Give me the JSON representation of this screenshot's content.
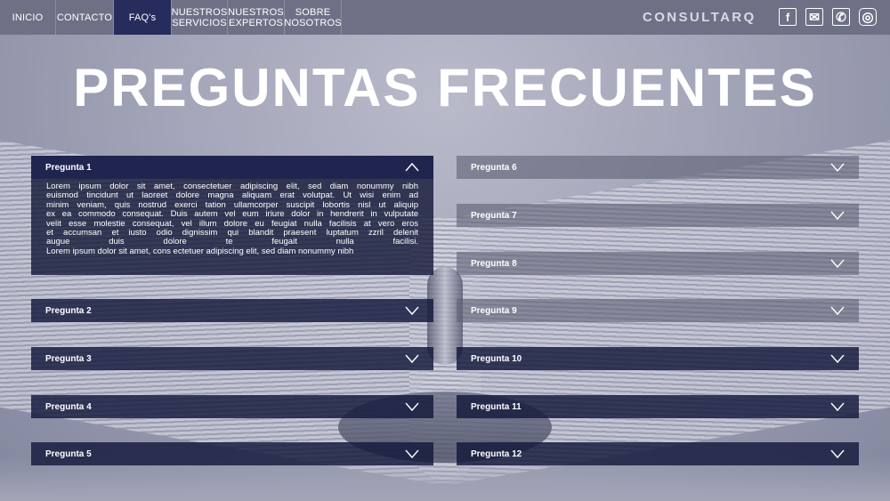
{
  "nav": {
    "items": [
      {
        "label": "INICIO"
      },
      {
        "label": "CONTACTO"
      },
      {
        "label": "FAQ's"
      },
      {
        "label": "NUESTROS SERVICIOS"
      },
      {
        "label": "NUESTROS EXPERTOS"
      },
      {
        "label": "SOBRE NOSOTROS"
      }
    ],
    "brand": "CONSULTARQ",
    "social_icons": [
      "facebook-icon",
      "mail-icon",
      "phone-icon",
      "instagram-icon"
    ],
    "social_glyphs": {
      "facebook": "f",
      "mail": "✉",
      "phone": "✆",
      "instagram": "◎"
    }
  },
  "page_title": "PREGUNTAS FRECUENTES",
  "colors": {
    "nav_bg": "#6e7186",
    "active_tab": "#262c5c",
    "panel_dark": "#20254f"
  },
  "faq": {
    "left": [
      {
        "label": "Pregunta 1",
        "expanded": true
      },
      {
        "label": "Pregunta 2"
      },
      {
        "label": "Pregunta 3"
      },
      {
        "label": "Pregunta 4"
      },
      {
        "label": "Pregunta 5"
      }
    ],
    "right": [
      {
        "label": "Pregunta 6"
      },
      {
        "label": "Pregunta 7"
      },
      {
        "label": "Pregunta 8"
      },
      {
        "label": "Pregunta 9"
      },
      {
        "label": "Pregunta 10"
      },
      {
        "label": "Pregunta 11"
      },
      {
        "label": "Pregunta 12"
      }
    ],
    "answer_lines": [
      "Lorem ipsum dolor sit amet, consectetuer adipiscing elit, sed diam nonummy nibh",
      "euismod tincidunt ut laoreet dolore magna aliquam erat volutpat. Ut wisi enim ad",
      "minim veniam, quis nostrud exerci tation ullamcorper suscipit lobortis nisl ut aliquip",
      "ex ea commodo consequat. Duis autem vel eum iriure dolor in hendrerit in vulputate",
      "velit esse molestie consequat, vel illum dolore eu feugiat nulla facilisis at vero eros",
      "et accumsan et iusto odio dignissim qui blandit praesent luptatum zzril delenit",
      "augue duis dolore te feugait nulla facilisi.",
      "Lorem ipsum dolor sit amet, cons ectetuer adipiscing elit, sed diam nonummy nibh"
    ]
  }
}
